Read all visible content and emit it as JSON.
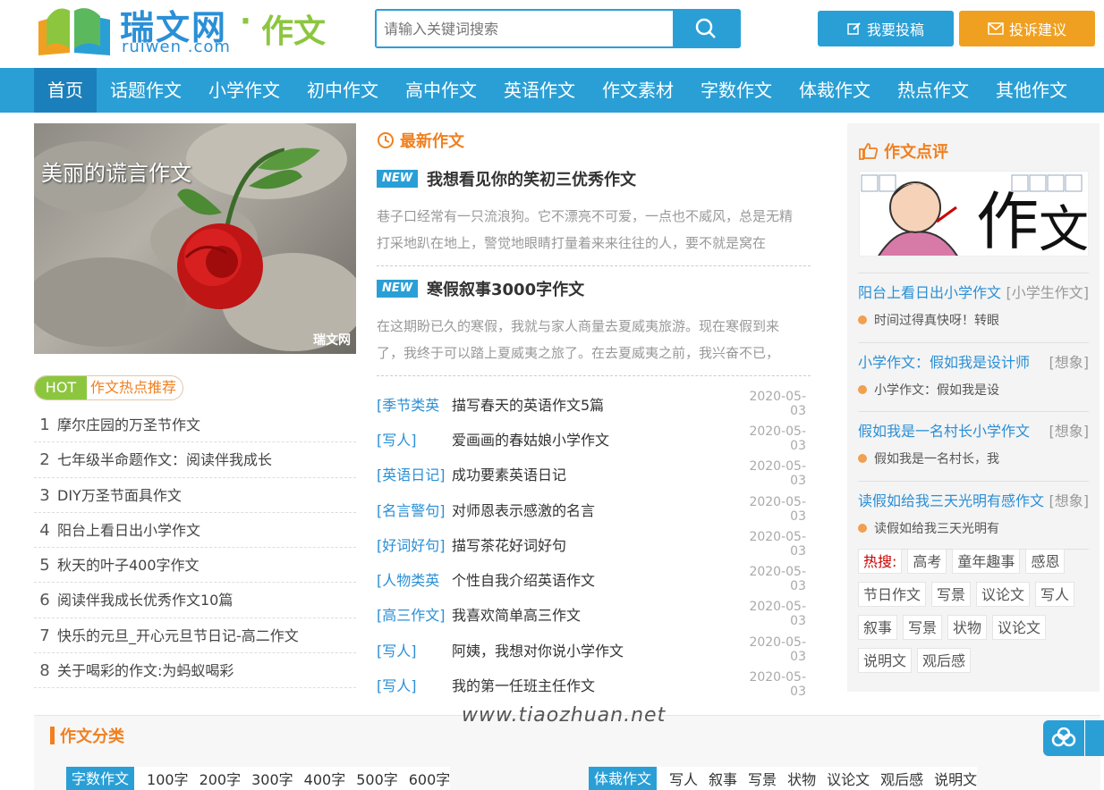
{
  "header": {
    "logo_cn": "瑞文网",
    "logo_en": "ruiwen .com",
    "logo_dot": "·",
    "logo_section": "作文",
    "search_placeholder": "请输入关键词搜索",
    "submit_label": "我要投稿",
    "feedback_label": "投诉建议"
  },
  "nav": [
    "首页",
    "话题作文",
    "小学作文",
    "初中作文",
    "高中作文",
    "英语作文",
    "作文素材",
    "字数作文",
    "体裁作文",
    "热点作文",
    "其他作文"
  ],
  "left": {
    "banner_title": "美丽的谎言作文",
    "banner_watermark": "瑞文网",
    "hot_label": "HOT",
    "hot_text": "作文热点推荐",
    "hot_items": [
      {
        "num": "1",
        "title": "摩尔庄园的万圣节作文"
      },
      {
        "num": "2",
        "title": "七年级半命题作文：阅读伴我成长"
      },
      {
        "num": "3",
        "title": "DIY万圣节面具作文"
      },
      {
        "num": "4",
        "title": "阳台上看日出小学作文"
      },
      {
        "num": "5",
        "title": "秋天的叶子400字作文"
      },
      {
        "num": "6",
        "title": "阅读伴我成长优秀作文10篇"
      },
      {
        "num": "7",
        "title": "快乐的元旦_开心元旦节日记-高二作文"
      },
      {
        "num": "8",
        "title": "关于喝彩的作文:为蚂蚁喝彩"
      }
    ]
  },
  "middle": {
    "section_title": "最新作文",
    "badge": "NEW",
    "articles": [
      {
        "title": "我想看见你的笑初三优秀作文",
        "desc": "巷子口经常有一只流浪狗。它不漂亮不可爱，一点也不威风，总是无精打采地趴在地上，警觉地眼睛打量着来来往往的人，要不就是窝在"
      },
      {
        "title": "寒假叙事3000字作文",
        "desc": "在这期盼已久的寒假，我就与家人商量去夏威夷旅游。现在寒假到来了，我终于可以踏上夏威夷之旅了。在去夏威夷之前，我兴奋不已，"
      }
    ],
    "news": [
      {
        "cat": "[季节类英",
        "title": "描写春天的英语作文5篇",
        "date": "2020-05-03"
      },
      {
        "cat": "[写人]",
        "title": "爱画画的春姑娘小学作文",
        "date": "2020-05-03"
      },
      {
        "cat": "[英语日记]",
        "title": "成功要素英语日记",
        "date": "2020-05-03"
      },
      {
        "cat": "[名言警句]",
        "title": "对师恩表示感激的名言",
        "date": "2020-05-03"
      },
      {
        "cat": "[好词好句]",
        "title": "描写茶花好词好句",
        "date": "2020-05-03"
      },
      {
        "cat": "[人物类英",
        "title": "个性自我介绍英语作文",
        "date": "2020-05-03"
      },
      {
        "cat": "[高三作文]",
        "title": "我喜欢简单高三作文",
        "date": "2020-05-03"
      },
      {
        "cat": "[写人]",
        "title": "阿姨，我想对你说小学作文",
        "date": "2020-05-03"
      },
      {
        "cat": "[写人]",
        "title": "我的第一任班主任作文",
        "date": "2020-05-03"
      }
    ]
  },
  "right": {
    "section_title": "作文点评",
    "reviews": [
      {
        "title": "阳台上看日出小学作文",
        "tag": "[小学生作文]",
        "sub": "时间过得真快呀！转眼"
      },
      {
        "title": "小学作文：假如我是设计师",
        "tag": "[想象]",
        "sub": "小学作文：假如我是设"
      },
      {
        "title": "假如我是一名村长小学作文",
        "tag": "[想象]",
        "sub": "假如我是一名村长，我"
      },
      {
        "title": "读假如给我三天光明有感作文",
        "tag": "[想象]",
        "sub": "读假如给我三天光明有"
      }
    ],
    "hot_search_label": "热搜:",
    "tags": [
      "高考",
      "童年趣事",
      "感恩",
      "节日作文",
      "写景",
      "议论文",
      "写人",
      "叙事",
      "写景",
      "状物",
      "议论文",
      "说明文",
      "观后感"
    ]
  },
  "category": {
    "title": "作文分类",
    "row1_label": "字数作文",
    "row1_links": [
      "100字",
      "200字",
      "300字",
      "400字",
      "500字",
      "600字"
    ],
    "row2_label": "体裁作文",
    "row2_links": [
      "写人",
      "叙事",
      "写景",
      "状物",
      "议论文",
      "观后感",
      "说明文"
    ]
  },
  "watermark": "www.tiaozhuan.net",
  "colors": {
    "primary": "#2a9fd6",
    "accent": "#f08020",
    "green": "#8cc63f"
  }
}
